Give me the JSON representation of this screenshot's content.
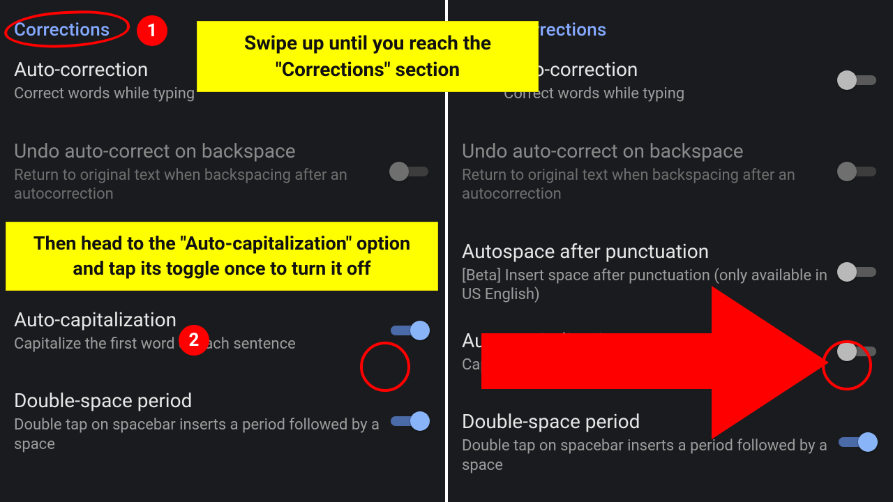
{
  "annotations": {
    "callout1": "Swipe up until you reach the \"Corrections\" section",
    "callout2": "Then head to the \"Auto-capitalization\" option and tap its toggle once to turn it off",
    "badge1": "1",
    "badge2": "2"
  },
  "left": {
    "section": "Corrections",
    "items": [
      {
        "title": "Auto-correction",
        "subtitle": "Correct words while typing",
        "toggle": "none",
        "disabled": false
      },
      {
        "title": "Undo auto-correct on backspace",
        "subtitle": "Return to original text when backspacing after an autocorrection",
        "toggle": "off-dim",
        "disabled": true
      },
      {
        "title": "Auto-capitalization",
        "subtitle": "Capitalize the first word of each sentence",
        "toggle": "on",
        "disabled": false
      },
      {
        "title": "Double-space period",
        "subtitle": "Double tap on spacebar inserts a period followed by a space",
        "toggle": "on",
        "disabled": false
      }
    ]
  },
  "right": {
    "section": "Corrections",
    "items": [
      {
        "title": "Auto-correction",
        "subtitle": "Correct words while typing",
        "toggle": "off",
        "disabled": false
      },
      {
        "title": "Undo auto-correct on backspace",
        "subtitle": "Return to original text when backspacing after an autocorrection",
        "toggle": "off-dim",
        "disabled": true
      },
      {
        "title": "Autospace after punctuation",
        "subtitle": "[Beta] Insert space after punctuation (only available in US English)",
        "toggle": "off",
        "disabled": false
      },
      {
        "title": "Auto-capitalization",
        "subtitle": "Capitalize the first word of each sentence",
        "toggle": "off",
        "disabled": false
      },
      {
        "title": "Double-space period",
        "subtitle": "Double tap on spacebar inserts a period followed by a space",
        "toggle": "on",
        "disabled": false
      }
    ]
  }
}
